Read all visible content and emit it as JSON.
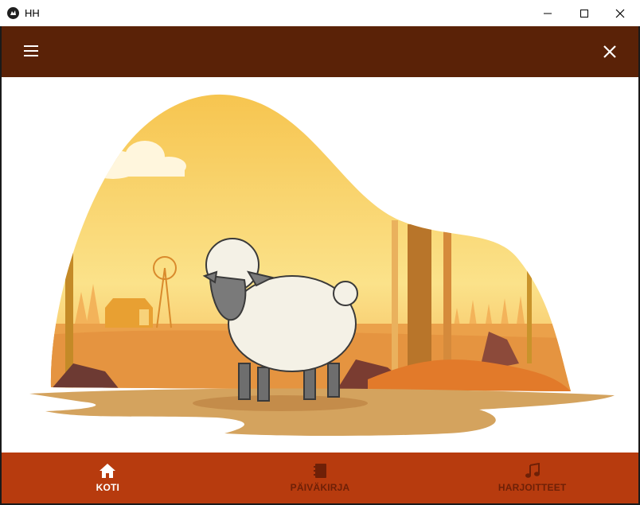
{
  "window": {
    "title": "HH"
  },
  "appbar": {
    "menu_icon": "menu-icon",
    "close_icon": "close-icon",
    "color": "#5a2207"
  },
  "nav": {
    "color": "#b73b0e",
    "items": [
      {
        "label": "KOTI",
        "icon": "home-icon",
        "active": true
      },
      {
        "label": "PÄIVÄKIRJA",
        "icon": "notebook-icon",
        "active": false
      },
      {
        "label": "HARJOITTEET",
        "icon": "music-note-icon",
        "active": false
      }
    ]
  }
}
